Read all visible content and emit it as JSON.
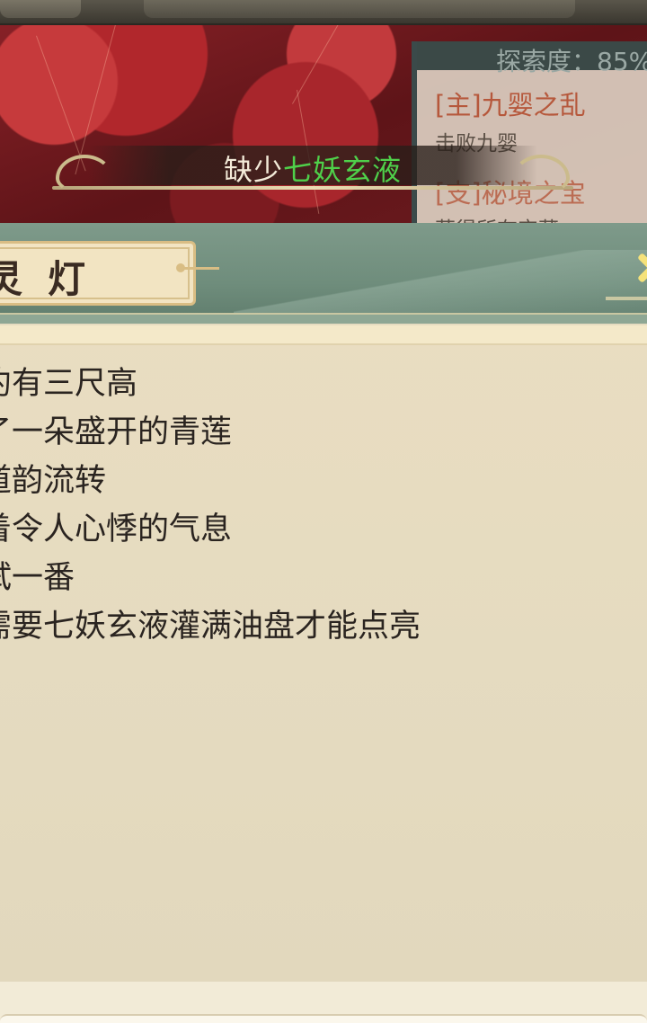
{
  "quest_panel": {
    "exploration_label": "探索度：85%",
    "quests": [
      {
        "title": "[主]九婴之乱",
        "subtitle": "击败九婴"
      },
      {
        "title": "[支]秘境之宝",
        "subtitle": "获得所有宝藏"
      }
    ]
  },
  "toast": {
    "prefix": "缺少",
    "item": "七妖玄液"
  },
  "dialog": {
    "title": "灵灯",
    "lines": [
      "约有三尺高",
      "了一朵盛开的青莲",
      "道韵流转",
      "着令人心悸的气息",
      "试一番",
      "需要七妖玄液灌满油盘才能点亮"
    ]
  },
  "colors": {
    "highlight": "#4fd04a",
    "quest_title": "#b6583c",
    "dialog_header": "#6f8d7c"
  }
}
